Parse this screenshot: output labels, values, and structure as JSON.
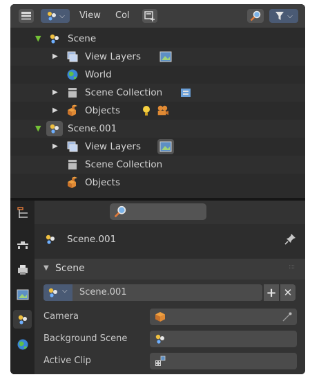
{
  "outliner": {
    "header": {
      "view_menu": "View",
      "col_menu": "Col"
    },
    "tree": [
      {
        "label": "Scene"
      },
      {
        "label": "View Layers"
      },
      {
        "label": "World"
      },
      {
        "label": "Scene Collection"
      },
      {
        "label": "Objects"
      },
      {
        "label": "Scene.001"
      },
      {
        "label": "View Layers"
      },
      {
        "label": "Scene Collection"
      },
      {
        "label": "Objects"
      }
    ]
  },
  "properties": {
    "context_title": "Scene.001",
    "panel_title": "Scene",
    "datablock": {
      "name": "Scene.001",
      "add_label": "+",
      "remove_label": "✕"
    },
    "fields": [
      {
        "label": "Camera"
      },
      {
        "label": "Background Scene"
      },
      {
        "label": "Active Clip"
      }
    ]
  },
  "colors": {
    "expand_open": "#74c236",
    "panel_bg": "#333333",
    "field_bg": "#4b4b4b"
  }
}
